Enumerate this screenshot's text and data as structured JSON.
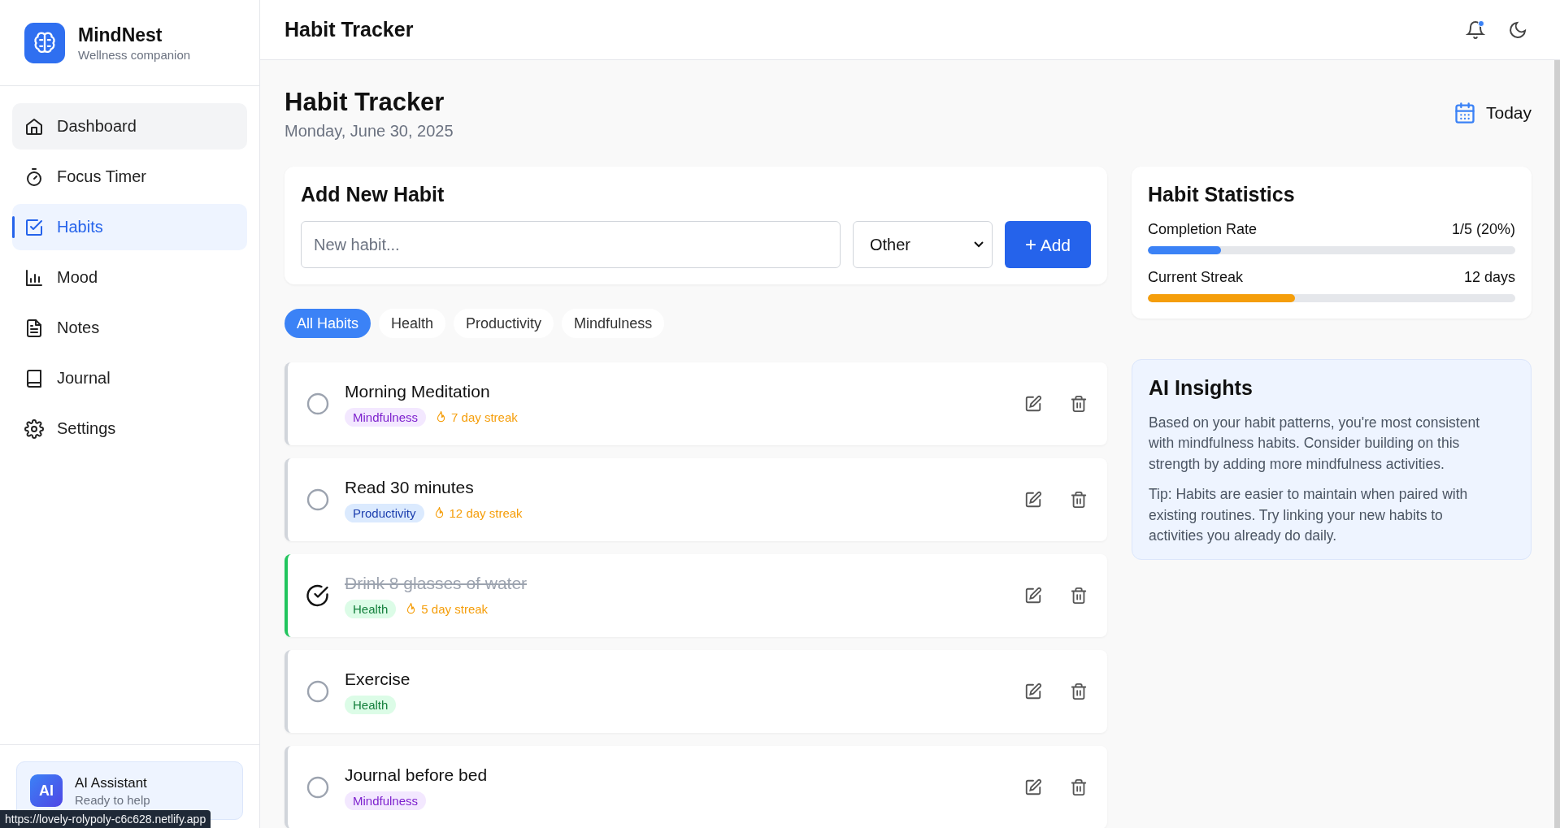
{
  "brand": {
    "name": "MindNest",
    "tagline": "Wellness companion"
  },
  "nav": [
    {
      "label": "Dashboard",
      "kind": "home",
      "selected": false,
      "hover": true
    },
    {
      "label": "Focus Timer",
      "kind": "timer",
      "selected": false,
      "hover": false
    },
    {
      "label": "Habits",
      "kind": "check",
      "selected": true,
      "hover": false
    },
    {
      "label": "Mood",
      "kind": "chart",
      "selected": false,
      "hover": false
    },
    {
      "label": "Notes",
      "kind": "file",
      "selected": false,
      "hover": false
    },
    {
      "label": "Journal",
      "kind": "book",
      "selected": false,
      "hover": false
    },
    {
      "label": "Settings",
      "kind": "gear",
      "selected": false,
      "hover": false
    }
  ],
  "assistant": {
    "badge": "AI",
    "title": "AI Assistant",
    "status": "Ready to help"
  },
  "status_url": "https://lovely-rolypoly-c6c628.netlify.app",
  "header": {
    "title": "Habit Tracker",
    "notification_unread": true
  },
  "page": {
    "title": "Habit Tracker",
    "date": "Monday, June 30, 2025",
    "today_button": "Today"
  },
  "add_habit": {
    "title": "Add New Habit",
    "placeholder": "New habit...",
    "category": "Other",
    "button": "Add",
    "button_icon": "+"
  },
  "filters": [
    {
      "label": "All Habits",
      "selected": true
    },
    {
      "label": "Health",
      "selected": false
    },
    {
      "label": "Productivity",
      "selected": false
    },
    {
      "label": "Mindfulness",
      "selected": false
    }
  ],
  "habits": [
    {
      "name": "Morning Meditation",
      "checked": false,
      "category": "Mindfulness",
      "color": "#7e22ce",
      "streak": "7 day streak"
    },
    {
      "name": "Read 30 minutes",
      "checked": false,
      "category": "Productivity",
      "color": "#1e40af",
      "streak": "12 day streak"
    },
    {
      "name": "Drink 8 glasses of water",
      "checked": true,
      "category": "Health",
      "color": "#15803d",
      "streak": "5 day streak"
    },
    {
      "name": "Exercise",
      "checked": false,
      "category": "Health",
      "color": "#15803d"
    },
    {
      "name": "Journal before bed",
      "checked": false,
      "category": "Mindfulness",
      "color": "#7e22ce"
    }
  ],
  "statistics": {
    "title": "Habit Statistics",
    "items": [
      {
        "label": "Completion Rate",
        "reading": "1/5 (20%)",
        "level": 0.2,
        "color": "#3b82f6"
      },
      {
        "label": "Current Streak",
        "reading": "12 days",
        "level": 0.4,
        "color": "#f59e0b"
      }
    ]
  },
  "insights": {
    "title": "AI Insights",
    "paragraphs": [
      "Based on your habit patterns, you're most consistent with mindfulness habits. Consider building on this strength by adding more mindfulness activities.",
      "Tip: Habits are easier to maintain when paired with existing routines. Try linking your new habits to activities you already do daily."
    ]
  }
}
